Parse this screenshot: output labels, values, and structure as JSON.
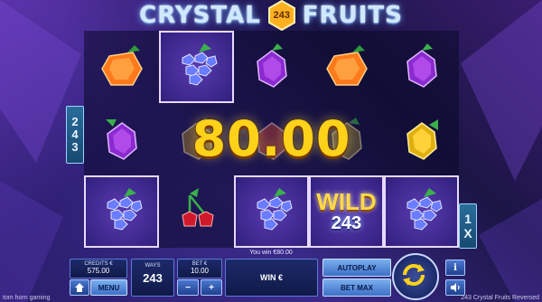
{
  "title": {
    "word_left": "CRYSTAL",
    "badge": "243",
    "word_right": "FRUITS"
  },
  "reels": [
    [
      "orange",
      "grapes",
      "plum",
      "orange",
      "plum"
    ],
    [
      "plum",
      "plum",
      "plum",
      "plum",
      "lemon"
    ],
    [
      "grapes",
      "cherries",
      "grapes",
      "wild",
      "grapes"
    ]
  ],
  "wild_symbol": {
    "word": "WILD",
    "number": "243"
  },
  "win_amount": "80.00",
  "side_ways": [
    "2",
    "4",
    "3"
  ],
  "side_multiplier": [
    "1",
    "X"
  ],
  "you_win_text": "You win €80.00",
  "credits": {
    "label": "CREDITS €",
    "value": "575.00"
  },
  "ways": {
    "label": "WAYS",
    "value": "243"
  },
  "bet": {
    "label": "BET €",
    "value": "10.00"
  },
  "win_field": {
    "label": "WIN €"
  },
  "buttons": {
    "menu": "MENU",
    "autoplay": "AUTOPLAY",
    "bet_max": "BET MAX",
    "bet_minus": "−",
    "bet_plus": "+",
    "info": "i",
    "home_icon": "home-icon",
    "sound_icon": "speaker-icon"
  },
  "footer": {
    "provider": "tom horn gaming",
    "game": "243 Crystal Fruits Reversed"
  },
  "colors": {
    "win_gold": "#ffd21a",
    "panel_blue": "#1c2a6a",
    "accent_blue": "#5a7ad8"
  }
}
